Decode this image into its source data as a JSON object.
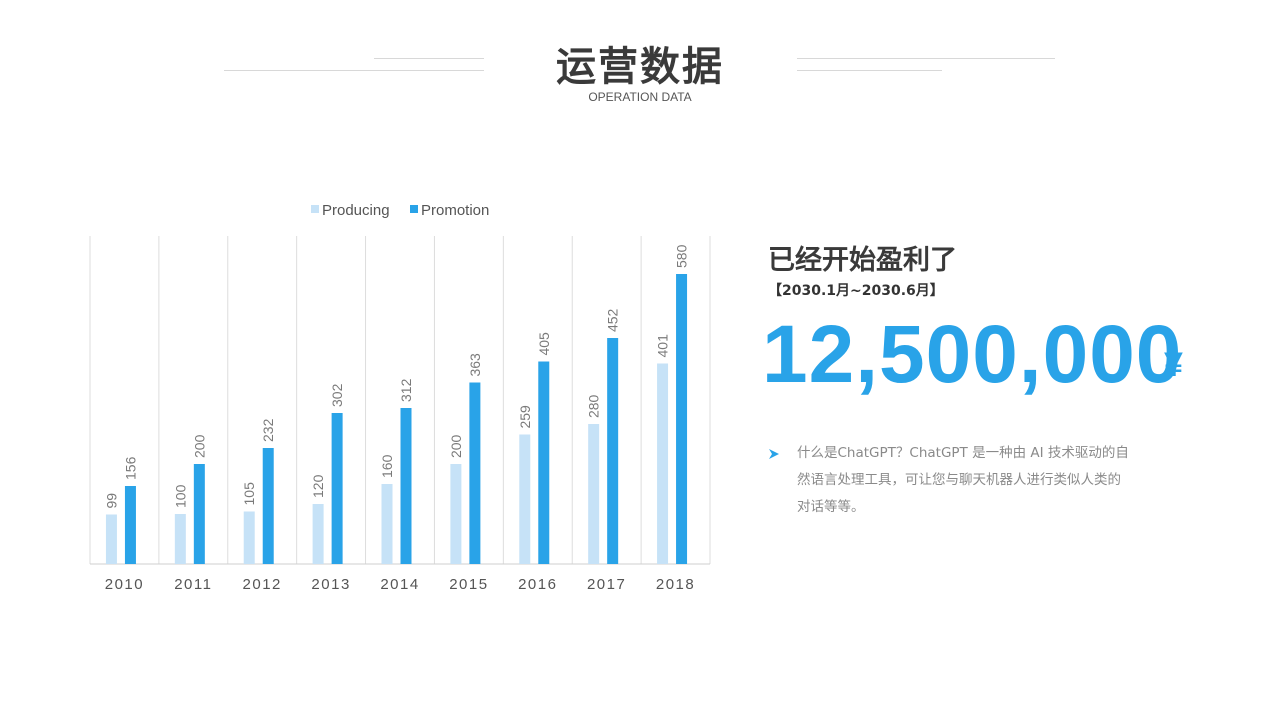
{
  "header": {
    "title": "运营数据",
    "subtitle": "OPERATION DATA"
  },
  "profit": {
    "title": "已经开始盈利了",
    "period": "【2030.1月~2030.6月】",
    "amount": "12,500,000",
    "currency": "¥",
    "description": "什么是ChatGPT？ChatGPT 是一种由 AI 技术驱动的自然语言处理工具，可让您与聊天机器人进行类似人类的对话等等。"
  },
  "colors": {
    "accent": "#29a3e8",
    "producing": "#c6e2f7",
    "promotion": "#29a3e8"
  },
  "chart_data": {
    "type": "bar",
    "categories": [
      "2010",
      "2011",
      "2012",
      "2013",
      "2014",
      "2015",
      "2016",
      "2017",
      "2018"
    ],
    "series": [
      {
        "name": "Producing",
        "values": [
          99,
          100,
          105,
          120,
          160,
          200,
          259,
          280,
          401
        ]
      },
      {
        "name": "Promotion",
        "values": [
          156,
          200,
          232,
          302,
          312,
          363,
          405,
          452,
          580
        ]
      }
    ],
    "title": "",
    "xlabel": "",
    "ylabel": "",
    "ylim": [
      0,
      700
    ],
    "grid": "vertical",
    "legend": "top-center",
    "data_labels": true
  }
}
